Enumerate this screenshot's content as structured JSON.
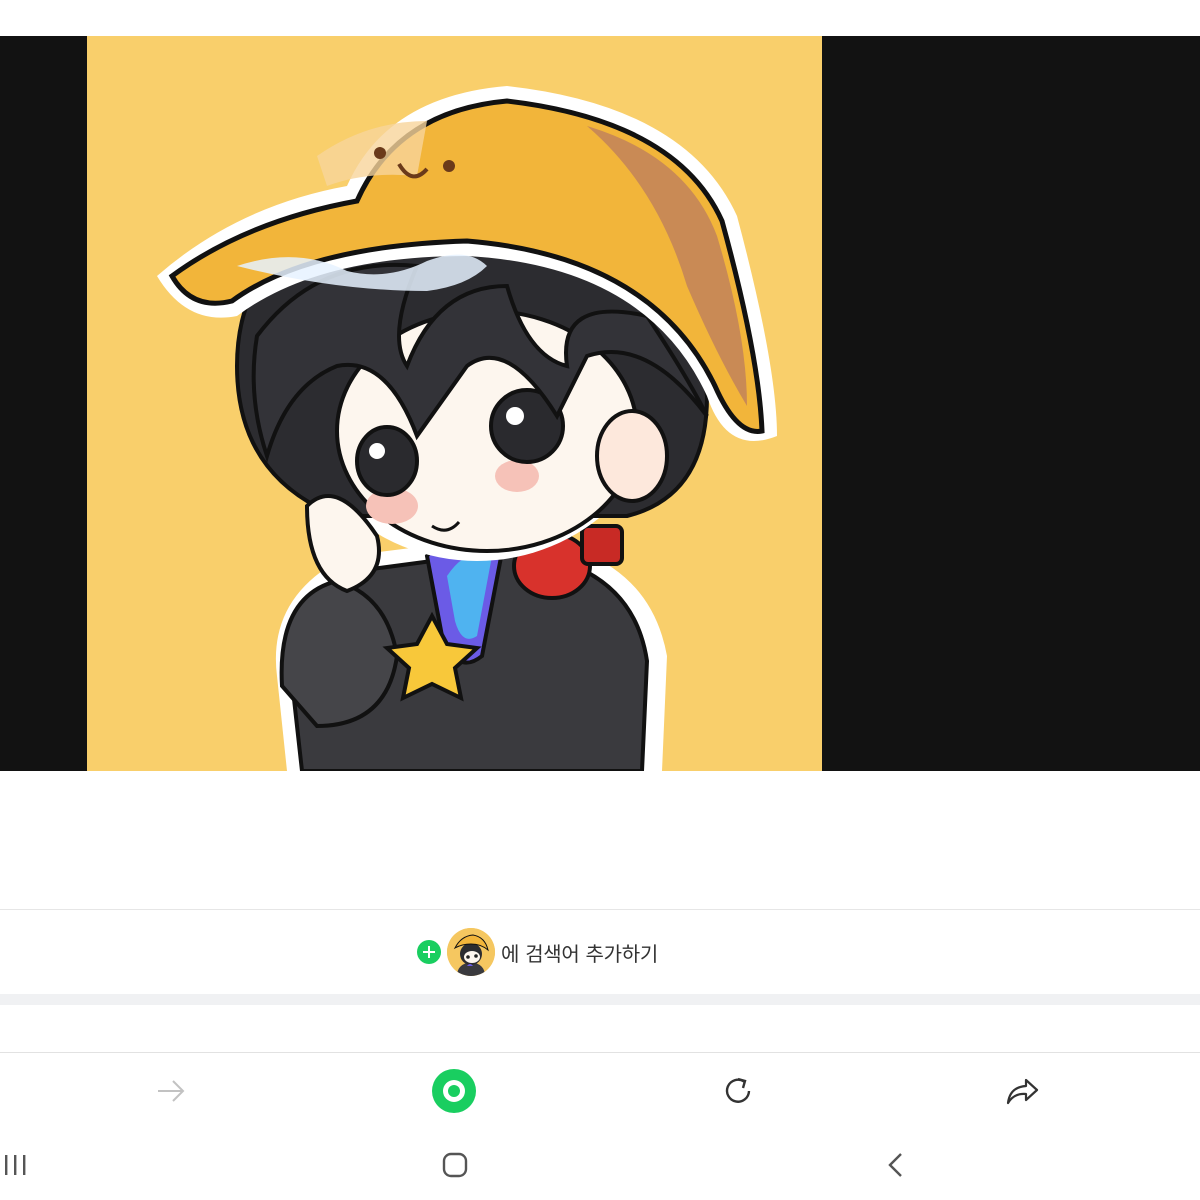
{
  "viewer": {
    "background_color": "#121212",
    "artwork_background": "#f9cf6b",
    "image_content": "chibi-character-yellow-bucket-hat"
  },
  "keyword": {
    "add_icon": "plus-circle-icon",
    "suffix_text": "에 검색어 추가하기",
    "accent_color": "#19ce60"
  },
  "toolbar": {
    "forward_icon": "arrow-right-icon",
    "home_icon": "green-ring-home-icon",
    "refresh_icon": "refresh-icon",
    "share_icon": "share-icon"
  },
  "navbar": {
    "recent_icon": "recent-apps-icon",
    "home_icon": "home-square-icon",
    "back_icon": "back-chevron-icon"
  }
}
